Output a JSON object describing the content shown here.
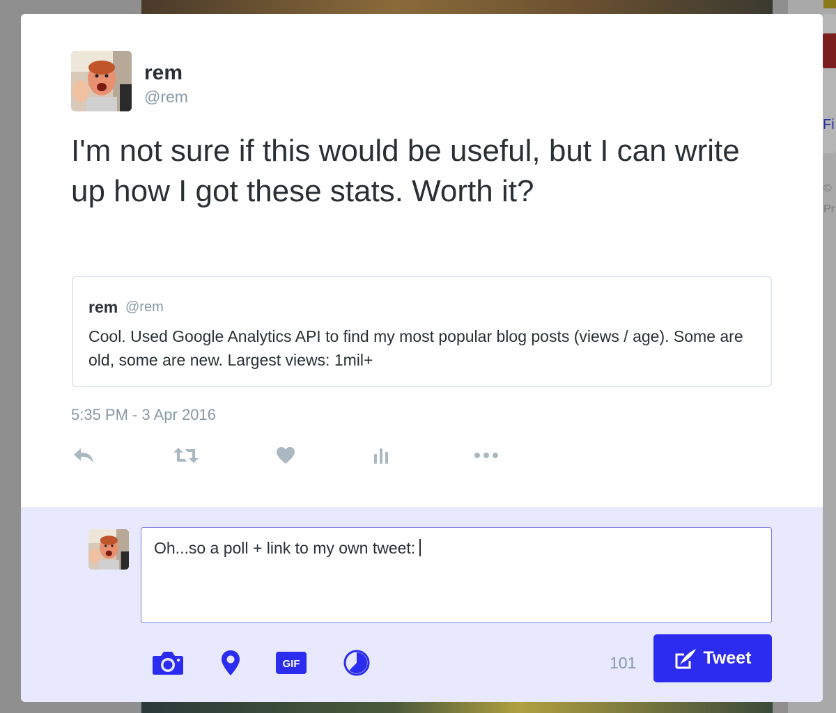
{
  "tweet": {
    "author_name": "rem",
    "author_handle": "@rem",
    "text": "I'm not sure if this would be useful, but I can write up how I got these stats. Worth it?",
    "timestamp": "5:35 PM - 3 Apr 2016",
    "quoted": {
      "author_name": "rem",
      "author_handle": "@rem",
      "text": "Cool. Used Google Analytics API to find my most popular blog posts (views / age). Some are old, some are new. Largest views: 1mil+"
    },
    "actions": [
      "reply-icon",
      "retweet-icon",
      "heart-icon",
      "analytics-icon",
      "more-icon"
    ]
  },
  "reply": {
    "text": "Oh...so a poll + link to my own tweet:",
    "char_count": "101",
    "tools": [
      "camera-icon",
      "location-pin-icon",
      "gif-icon",
      "poll-icon"
    ],
    "tweet_button_label": "Tweet"
  },
  "background": {
    "fi": "Fi",
    "copy_line1": "©",
    "copy_line2": "Pr"
  },
  "colors": {
    "accent": "#2c2cf0",
    "reply_bg": "#e8e8ff",
    "muted": "#8899a6",
    "text": "#292f33"
  }
}
